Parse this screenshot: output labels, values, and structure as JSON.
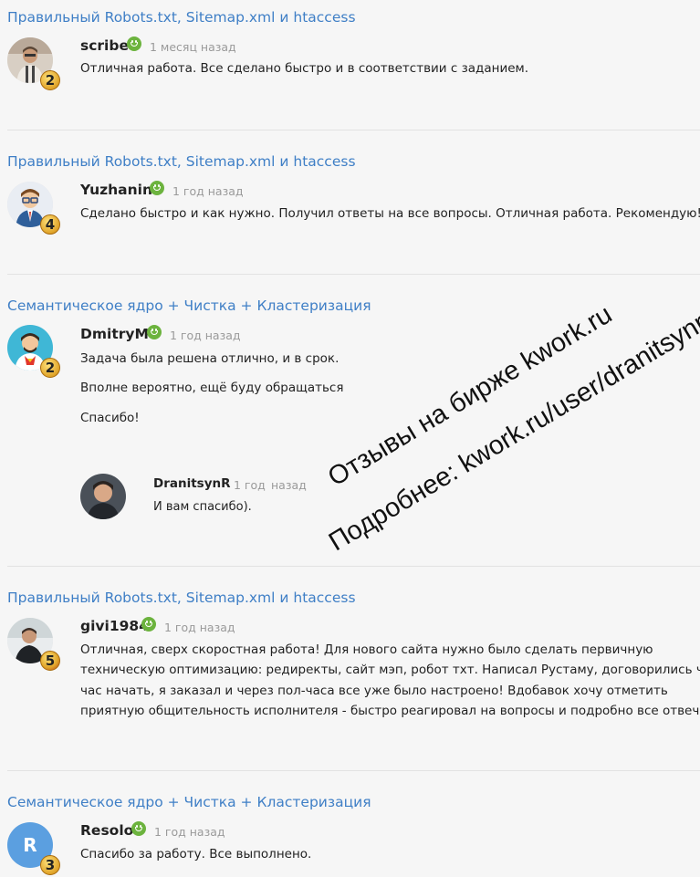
{
  "reviews": [
    {
      "kwork_title": "Правильный Robots.txt, Sitemap.xml и htaccess",
      "username": "scribe",
      "date": "1 месяц назад",
      "level": "2",
      "paragraphs": [
        "Отличная работа. Все сделано быстро и в соответствии с заданием."
      ]
    },
    {
      "kwork_title": "Правильный Robots.txt, Sitemap.xml и htaccess",
      "username": "Yuzhanin",
      "date": "1 год назад",
      "level": "4",
      "paragraphs": [
        "Сделано быстро и как нужно. Получил ответы на все вопросы. Отличная работа. Рекомендую!"
      ]
    },
    {
      "kwork_title": "Семантическое ядро + Чистка + Кластеризация",
      "username": "DmitryM",
      "date": "1 год назад",
      "level": "2",
      "paragraphs": [
        "Задача была решена отлично, и в срок.",
        "Вполне вероятно, ещё буду обращаться",
        "Спасибо!"
      ],
      "reply": {
        "username": "DranitsynR",
        "date_part1": "1 год",
        "date_part2": "назад",
        "text": "И вам спасибо)."
      }
    },
    {
      "kwork_title": "Правильный Robots.txt, Sitemap.xml и htaccess",
      "username": "givi1984",
      "date": "1 год назад",
      "level": "5",
      "lines": [
        "Отличная, сверх скоростная работа! Для нового сайта нужно было сделать первичную",
        "техническую оптимизацию: редиректы, сайт мэп, робот тхт. Написал Рустаму, договорились через",
        "час начать, я заказал и через пол-часа все уже было настроено! Вдобавок хочу отметить",
        "приятную общительность исполнителя - быстро реагировал на вопросы и подробно все отвечал!"
      ]
    },
    {
      "kwork_title": "Семантическое ядро + Чистка + Кластеризация",
      "username": "Resolo",
      "date": "1 год назад",
      "level": "3",
      "avatar_letter": "R",
      "paragraphs": [
        "Спасибо за работу. Все выполнено."
      ]
    }
  ],
  "watermark": {
    "line1": "Отзывы на бирже kwork.ru",
    "line2": "Подробнее: kwork.ru/user/dranitsynr"
  },
  "colors": {
    "link": "#3f7fc6",
    "online": "#6cb33e",
    "resolo_avatar": "#5b9fe0"
  }
}
